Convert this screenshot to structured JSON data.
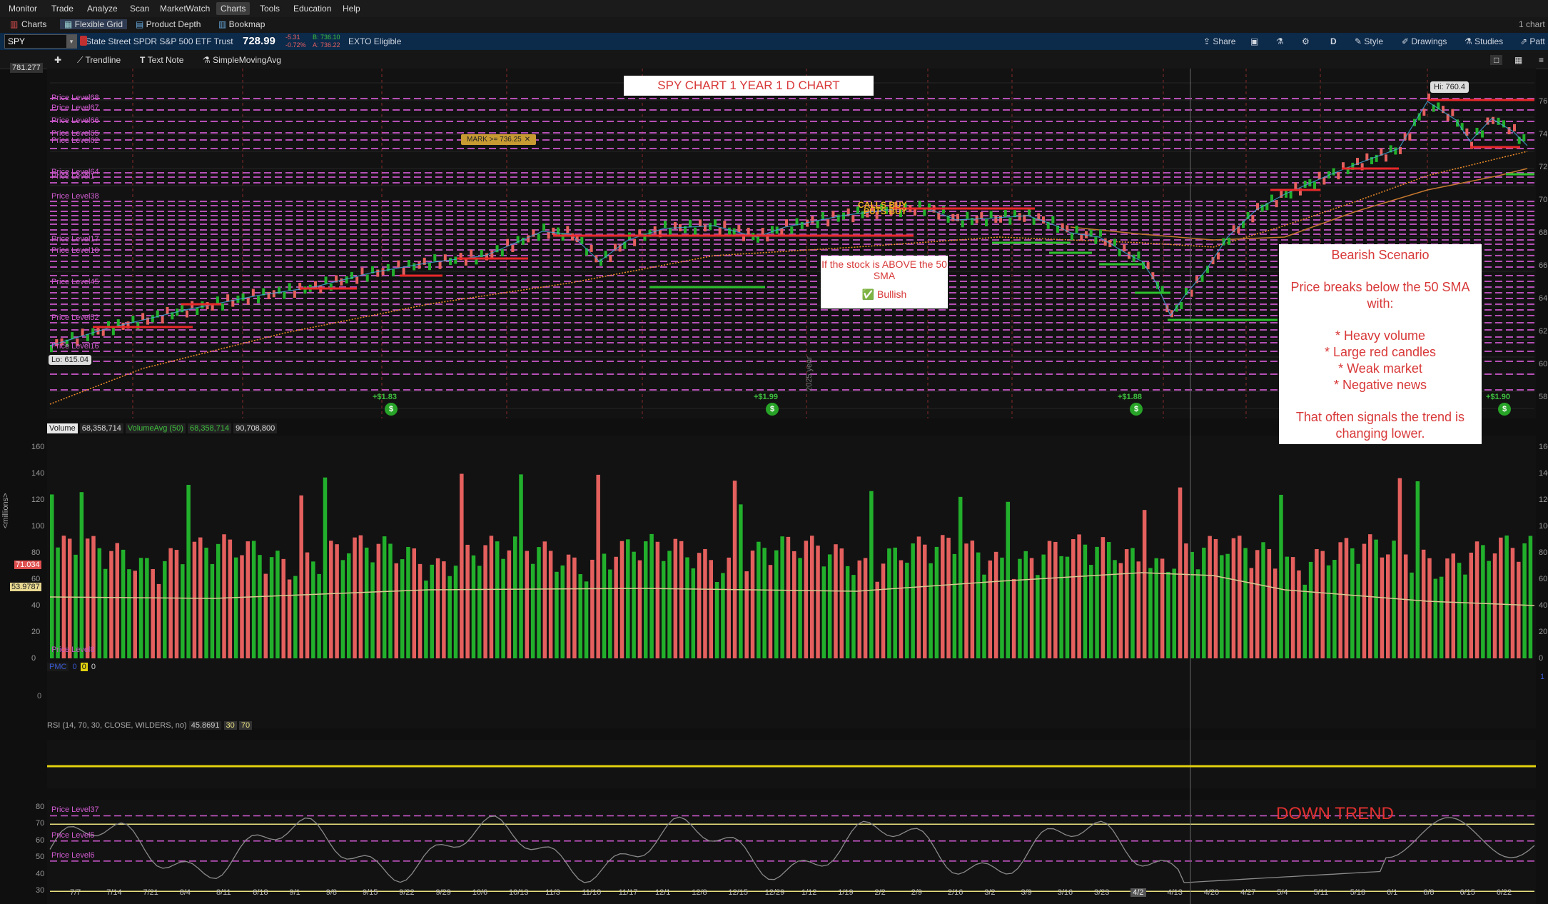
{
  "menu": [
    "Monitor",
    "Trade",
    "Analyze",
    "Scan",
    "MarketWatch",
    "Charts",
    "Tools",
    "Education",
    "Help"
  ],
  "subtabs": [
    "Charts",
    "Flexible Grid",
    "Product Depth",
    "Bookmap"
  ],
  "top_right": "1 chart",
  "symbol": {
    "ticker": "SPY",
    "name": "State Street SPDR S&P 500 ETF Trust",
    "last": "728.99",
    "change": "-5.31",
    "change_pct": "-0.72%",
    "bid": "B: 736.10",
    "ask": "A: 736.22",
    "ext": "EXTO Eligible"
  },
  "toolbar_right": [
    "Share",
    "D",
    "Style",
    "Drawings",
    "Studies",
    "Patt"
  ],
  "drawing_tools": [
    "Trendline",
    "Text Note",
    "SimpleMovingAvg"
  ],
  "price_axis": {
    "top_value": "781.277",
    "ticks": [
      "76",
      "74",
      "72",
      "70",
      "68",
      "66",
      "64",
      "62",
      "60",
      "58"
    ]
  },
  "price_levels": [
    "Price Level68",
    "Price Level67",
    "Price Level66",
    "Price Level65",
    "Price Level62",
    "Price Level64",
    "Price Level1",
    "Price Level38",
    "Price Level17",
    "Price Level10",
    "Price Level45",
    "Price Level52",
    "Price Level16"
  ],
  "annotations": {
    "chart_title": "SPY CHART 1 YEAR 1 D CHART",
    "mark": "MARK >= 736.25",
    "calls_buy": "CALLS BUY",
    "puts_buy": "PUTS BUY",
    "hi": "Hi: 760.4",
    "lo": "Lo: 615.04",
    "year_label": "2025 year",
    "dividends": [
      "+$1.83",
      "+$1.99",
      "+$1.88",
      "+$1.90"
    ],
    "bullish_note_title": "If the stock is ABOVE the 50 SMA",
    "bullish_note_body": "✅ Bullish",
    "bearish_title": "Bearish Scenario",
    "bearish_intro": "Price breaks below the 50 SMA with:",
    "bearish_points": [
      "* Heavy volume",
      "* Large red candles",
      "* Weak market",
      "* Negative news"
    ],
    "bearish_conclusion": "That often signals the trend is changing lower.",
    "down_trend": "DOWN TREND"
  },
  "volume_header": {
    "label": "Volume",
    "value": "68,358,714",
    "avg_label": "VolumeAvg (50)",
    "avg_value": "68,358,714",
    "third": "90,708,800"
  },
  "volume_axis": {
    "unit": "<millions>",
    "ticks": [
      "160",
      "140",
      "120",
      "100",
      "80",
      "60",
      "40",
      "20",
      "0"
    ],
    "current": "71.034",
    "avg": "53.9787"
  },
  "volume_level_label": "Price Level8",
  "pmc_header": {
    "label": "PMC",
    "v1": "0",
    "v2": "0",
    "v3": "0"
  },
  "pmc_axis": [
    "1",
    "0"
  ],
  "rsi_header": {
    "label": "RSI (14, 70, 30, CLOSE, WILDERS, no)",
    "value": "45.8691",
    "ob": "30",
    "os": "70"
  },
  "rsi_axis": [
    "80",
    "70",
    "60",
    "50",
    "40",
    "30"
  ],
  "rsi_levels": [
    "Price Level37",
    "Price Level5",
    "Price Level6"
  ],
  "x_dates": [
    "7/7",
    "7/14",
    "7/21",
    "8/4",
    "8/11",
    "8/18",
    "9/1",
    "9/8",
    "9/15",
    "9/22",
    "9/29",
    "10/6",
    "10/13",
    "11/3",
    "11/10",
    "11/17",
    "12/1",
    "12/8",
    "12/15",
    "12/29",
    "1/12",
    "1/19",
    "2/2",
    "2/9",
    "2/16",
    "3/2",
    "3/9",
    "3/16",
    "3/23",
    "4/2",
    "4/13",
    "4/20",
    "4/27",
    "5/4",
    "5/11",
    "5/18",
    "6/1",
    "6/8",
    "6/15",
    "6/22"
  ],
  "colors": {
    "up": "#22b02c",
    "down": "#e4605e",
    "level": "#d25ad2",
    "resist": "#e8282a",
    "support": "#2ec02e",
    "sma": "#f08c2a",
    "rsi_line": "#8a8a8a",
    "band": "#e8e080"
  }
}
